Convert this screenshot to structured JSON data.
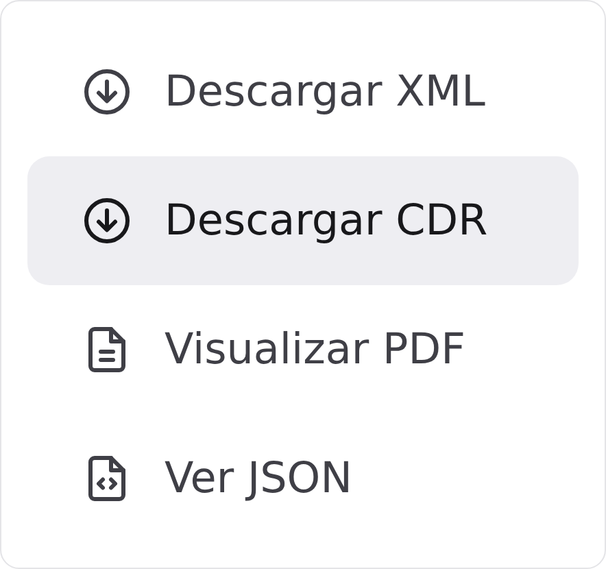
{
  "menu": {
    "items": [
      {
        "label": "Descargar XML",
        "kind": "download",
        "selected": false
      },
      {
        "label": "Descargar CDR",
        "kind": "download",
        "selected": true
      },
      {
        "label": "Visualizar PDF",
        "kind": "document",
        "selected": false
      },
      {
        "label": "Ver JSON",
        "kind": "code-file",
        "selected": false
      }
    ]
  }
}
